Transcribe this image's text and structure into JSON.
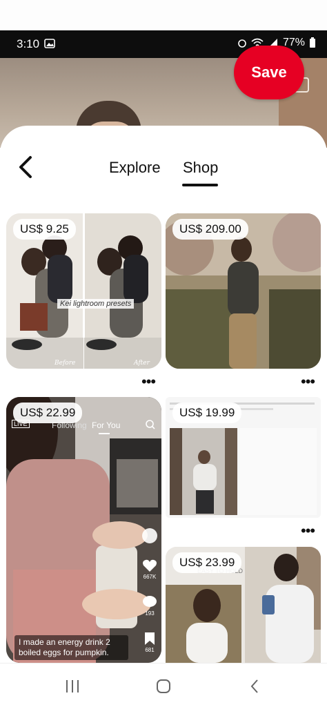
{
  "status_bar": {
    "time": "3:10",
    "battery": "77%"
  },
  "save_button": {
    "label": "Save"
  },
  "tabs": [
    {
      "label": "Explore",
      "active": false
    },
    {
      "label": "Shop",
      "active": true
    }
  ],
  "products": [
    {
      "price": "US$ 9.25",
      "overlay_text": "Kei lightroom presets",
      "before": "Before",
      "after": "After"
    },
    {
      "price": "US$ 209.00"
    },
    {
      "price": "US$ 22.99",
      "tiktok_following": "Following",
      "tiktok_for_you": "For You",
      "tiktok_live": "LIVE",
      "caption": "I made an energy drink 2 boiled eggs for pumpkin.",
      "stats": [
        "667K",
        "193",
        "681"
      ]
    },
    {
      "price": "US$ 19.99"
    },
    {
      "price": "US$ 23.99",
      "sub_text": "EASY TO HOLD"
    }
  ],
  "colors": {
    "accent": "#e60023",
    "status_bar": "#0d0d0d"
  },
  "icons": {
    "back": "chevron-left-icon",
    "more": "more-dots-icon",
    "nav_recent": "recent-apps-icon",
    "nav_home": "home-icon",
    "nav_back": "back-icon"
  }
}
